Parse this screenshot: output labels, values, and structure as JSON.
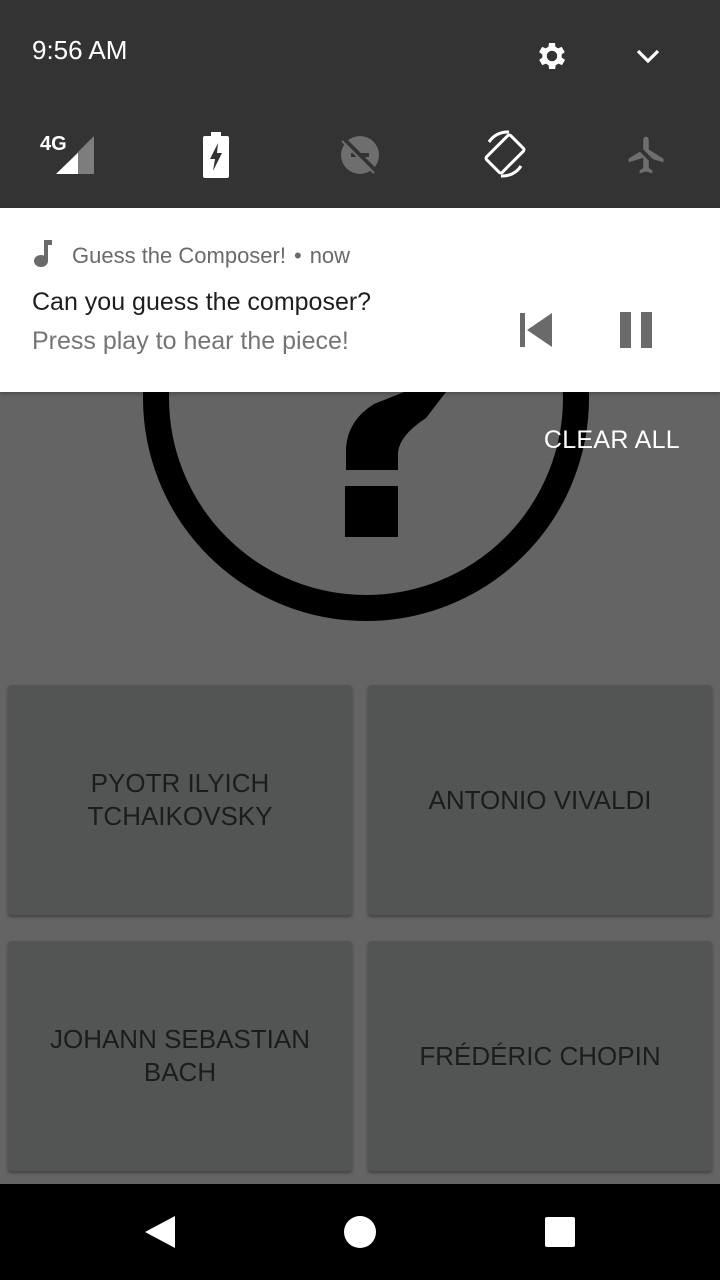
{
  "status": {
    "time": "9:56 AM",
    "network": "4G"
  },
  "quick_settings": {
    "icons": [
      "settings-gear-icon",
      "expand-chevron-icon",
      "signal-4g-icon",
      "battery-charging-icon",
      "data-saver-off-icon",
      "auto-rotate-icon",
      "airplane-mode-icon"
    ]
  },
  "notification": {
    "app_name": "Guess the Composer!",
    "separator": "•",
    "time": "now",
    "title": "Can you guess the composer?",
    "text": "Press play to hear the piece!",
    "actions": [
      "skip-previous-icon",
      "pause-icon"
    ]
  },
  "shade": {
    "clear_all": "CLEAR ALL"
  },
  "quiz": {
    "choices": [
      "PYOTR ILYICH TCHAIKOVSKY",
      "ANTONIO VIVALDI",
      "JOHANN SEBASTIAN BACH",
      "FRÉDÉRIC CHOPIN"
    ]
  },
  "colors": {
    "shade_bg": "#333333",
    "scrim_bg": "#646464",
    "button_bg": "#535555",
    "notification_bg": "#ffffff"
  }
}
